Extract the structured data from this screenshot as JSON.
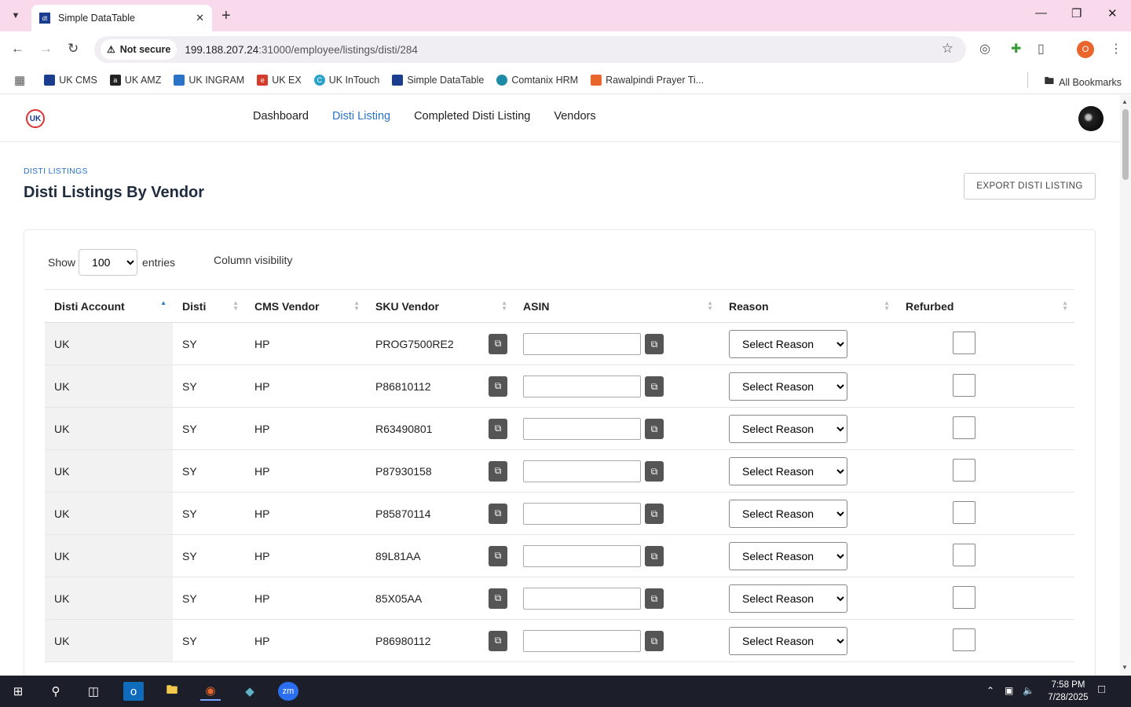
{
  "browser": {
    "tab_title": "Simple DataTable",
    "not_secure": "Not secure",
    "url_host": "199.188.207.24",
    "url_rest": ":31000/employee/listings/disti/284",
    "bookmarks": [
      {
        "label": "UK CMS",
        "color": "#1a3d8f"
      },
      {
        "label": "UK AMZ",
        "color": "#222222"
      },
      {
        "label": "UK INGRAM",
        "color": "#2a73c7"
      },
      {
        "label": "UK EX",
        "color": "#d33b2a"
      },
      {
        "label": "UK InTouch",
        "color": "#2aa2c7"
      },
      {
        "label": "Simple DataTable",
        "color": "#1a3d8f"
      },
      {
        "label": "Comtanix HRM",
        "color": "#1e8aa8"
      },
      {
        "label": "Rawalpindi Prayer Ti...",
        "color": "#e8652b"
      }
    ],
    "all_bookmarks": "All Bookmarks",
    "profile_initial": "O"
  },
  "nav": {
    "items": [
      "Dashboard",
      "Disti Listing",
      "Completed Disti Listing",
      "Vendors"
    ],
    "active": "Disti Listing"
  },
  "page": {
    "eyebrow": "DISTI LISTINGS",
    "title": "Disti Listings By Vendor",
    "export_label": "EXPORT DISTI LISTING",
    "show_label": "Show",
    "entries_value": "100",
    "entries_label": "entries",
    "column_visibility": "Column visibility"
  },
  "table": {
    "headers": [
      "Disti Account",
      "Disti",
      "CMS Vendor",
      "SKU Vendor",
      "ASIN",
      "Reason",
      "Refurbed"
    ],
    "reason_placeholder": "Select Reason",
    "rows": [
      {
        "account": "UK",
        "disti": "SY",
        "vendor": "HP",
        "sku": "PROG7500RE2"
      },
      {
        "account": "UK",
        "disti": "SY",
        "vendor": "HP",
        "sku": "P86810112"
      },
      {
        "account": "UK",
        "disti": "SY",
        "vendor": "HP",
        "sku": "R63490801"
      },
      {
        "account": "UK",
        "disti": "SY",
        "vendor": "HP",
        "sku": "P87930158"
      },
      {
        "account": "UK",
        "disti": "SY",
        "vendor": "HP",
        "sku": "P85870114"
      },
      {
        "account": "UK",
        "disti": "SY",
        "vendor": "HP",
        "sku": "89L81AA"
      },
      {
        "account": "UK",
        "disti": "SY",
        "vendor": "HP",
        "sku": "85X05AA"
      },
      {
        "account": "UK",
        "disti": "SY",
        "vendor": "HP",
        "sku": "P86980112"
      }
    ]
  },
  "taskbar": {
    "time": "7:58 PM",
    "date": "7/28/2025"
  }
}
